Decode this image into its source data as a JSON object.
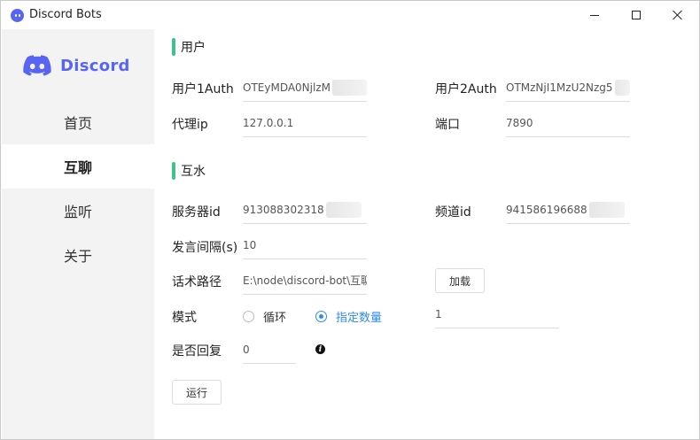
{
  "window": {
    "title": "Discord Bots"
  },
  "brand": {
    "name": "Discord",
    "color": "#5865f2"
  },
  "sidebar": {
    "items": [
      {
        "label": "首页",
        "active": false
      },
      {
        "label": "互聊",
        "active": true
      },
      {
        "label": "监听",
        "active": false
      },
      {
        "label": "关于",
        "active": false
      }
    ]
  },
  "sections": {
    "user": "用户",
    "interact": "互水"
  },
  "user": {
    "user1_label": "用户1Auth",
    "user1_value": "OTEyMDA0NjlzM",
    "user2_label": "用户2Auth",
    "user2_value": "OTMzNjI1MzU2Nzg5",
    "proxy_label": "代理ip",
    "proxy_value": "127.0.0.1",
    "port_label": "端口",
    "port_value": "7890"
  },
  "interact": {
    "server_label": "服务器id",
    "server_value": "913088302318",
    "channel_label": "频道id",
    "channel_value": "941586196688",
    "interval_label": "发言间隔(s)",
    "interval_value": "10",
    "script_label": "话术路径",
    "script_value": "E:\\node\\discord-bot\\互聊话",
    "load_button": "加载",
    "mode_label": "模式",
    "mode_options": [
      {
        "label": "循环",
        "checked": false
      },
      {
        "label": "指定数量",
        "checked": true
      }
    ],
    "count_value": "1",
    "reply_label": "是否回复",
    "reply_value": "0",
    "info_icon": "info-icon",
    "run_button": "运行"
  },
  "colors": {
    "accent_green": "#3ec48a",
    "radio_blue": "#2d8cf0"
  }
}
